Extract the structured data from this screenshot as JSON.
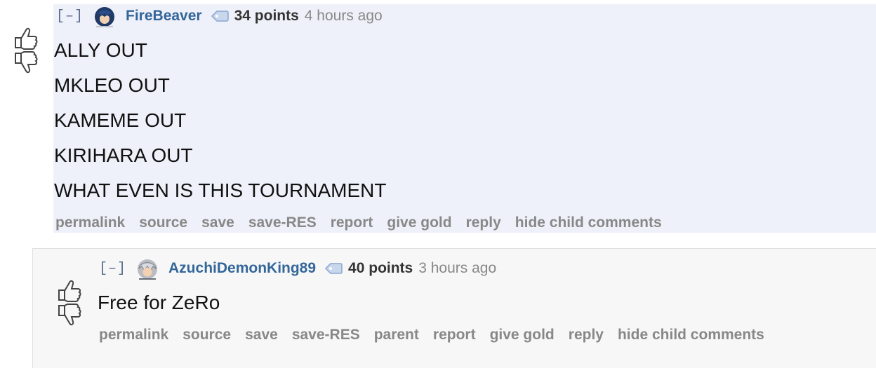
{
  "comment1": {
    "collapse": "[–]",
    "author": "FireBeaver",
    "score": "34 points",
    "time": "4 hours ago",
    "lines": [
      "ALLY OUT",
      "MKLEO OUT",
      "KAMEME OUT",
      "KIRIHARA OUT",
      "WHAT EVEN IS THIS TOURNAMENT"
    ],
    "actions": [
      "permalink",
      "source",
      "save",
      "save-RES",
      "report",
      "give gold",
      "reply",
      "hide child comments"
    ]
  },
  "comment2": {
    "collapse": "[–]",
    "author": "AzuchiDemonKing89",
    "score": "40 points",
    "time": "3 hours ago",
    "lines": [
      "Free for ZeRo"
    ],
    "actions": [
      "permalink",
      "source",
      "save",
      "save-RES",
      "parent",
      "report",
      "give gold",
      "reply",
      "hide child comments"
    ]
  },
  "colors": {
    "highlight": "#eff1fa",
    "author": "#336699",
    "muted": "#888888"
  }
}
